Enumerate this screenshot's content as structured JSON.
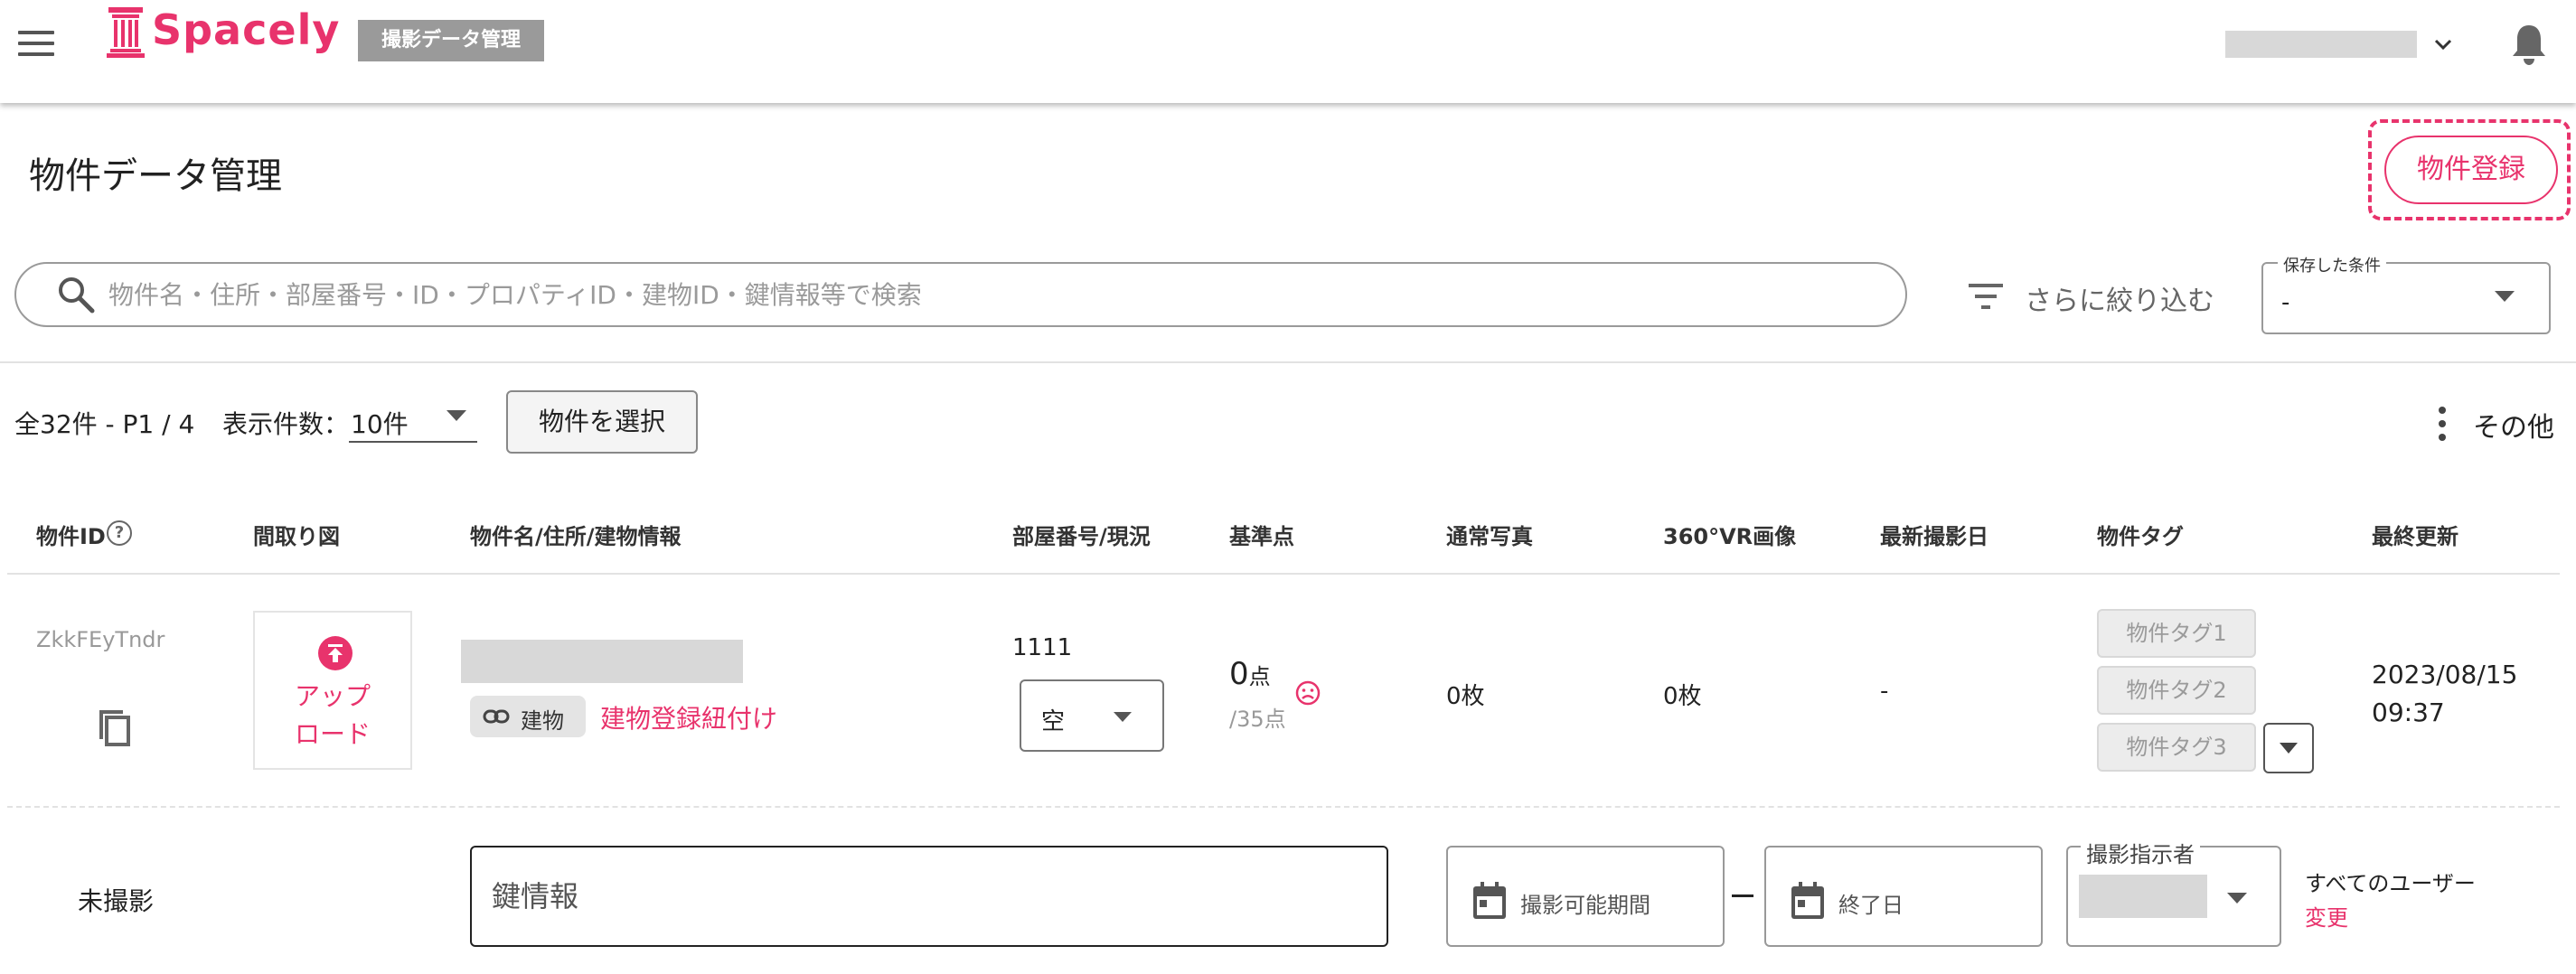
{
  "header": {
    "logo_text": "Spacely",
    "section_badge": "撮影データ管理",
    "brand_color": "#e8336c"
  },
  "page": {
    "title": "物件データ管理",
    "register_button": "物件登録"
  },
  "search": {
    "placeholder": "物件名・住所・部屋番号・ID・プロパティID・建物ID・鍵情報等で検索",
    "filter_label": "さらに絞り込む",
    "saved_conditions_label": "保存した条件",
    "saved_conditions_value": "-"
  },
  "toolbar": {
    "summary": "全32件 - P1 / 4",
    "per_page_label": "表示件数：",
    "per_page_value": "10件",
    "select_button": "物件を選択",
    "more_label": "その他"
  },
  "table": {
    "headers": [
      "物件ID",
      "間取り図",
      "物件名/住所/建物情報",
      "部屋番号/現況",
      "基準点",
      "通常写真",
      "360°VR画像",
      "最新撮影日",
      "物件タグ",
      "最終更新"
    ],
    "help_glyph": "?",
    "rows": [
      {
        "id": "ZkkFEyTndr",
        "upload_label_1": "アップ",
        "upload_label_2": "ロード",
        "building_chip": "建物",
        "building_link": "建物登録紐付け",
        "room_number": "1111",
        "room_status": "空",
        "score": "0",
        "score_unit": "点",
        "score_max": "/35点",
        "photos": "0枚",
        "vr_images": "0枚",
        "last_shoot": "-",
        "tags": [
          "物件タグ1",
          "物件タグ2",
          "物件タグ3"
        ],
        "updated_date": "2023/08/15",
        "updated_time": "09:37",
        "status": "未撮影",
        "key_info_placeholder": "鍵情報",
        "shoot_period_placeholder": "撮影可能期間",
        "end_date_placeholder": "終了日",
        "shooter_label": "撮影指示者",
        "shooter_scope": "すべてのユーザー",
        "change_link": "変更"
      }
    ]
  }
}
